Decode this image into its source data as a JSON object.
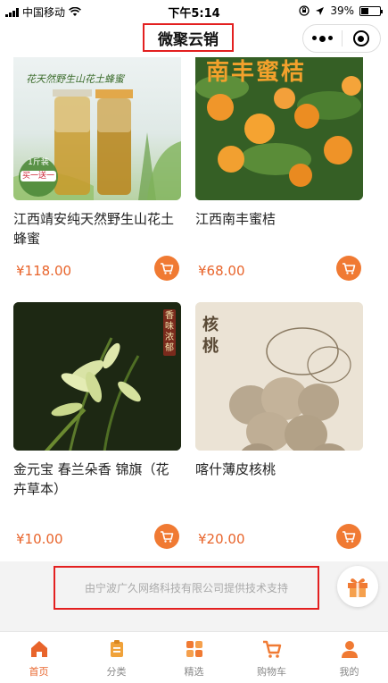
{
  "status_bar": {
    "carrier": "中国移动",
    "time": "下午5:14",
    "battery": "39%",
    "battery_level": 0.39
  },
  "nav": {
    "title": "微聚云销"
  },
  "products": [
    {
      "name": "江西靖安纯天然野生山花土蜂蜜",
      "price": "¥118.00",
      "image_text": "花天然野生山花土蜂蜜",
      "badge_line1": "1斤装",
      "badge_line2": "买一送一"
    },
    {
      "name": "江西南丰蜜桔",
      "price": "¥68.00",
      "image_text": "南丰蜜桔"
    },
    {
      "name": "金元宝 春兰朵香 锦旗（花卉草本）",
      "price": "¥10.00",
      "image_text": "香味浓郁"
    },
    {
      "name": "喀什薄皮核桃",
      "price": "¥20.00",
      "image_text": "核桃"
    }
  ],
  "footer": {
    "support_text": "由宁波广久网络科技有限公司提供技术支持"
  },
  "tabs": [
    {
      "label": "首页",
      "icon": "home-icon",
      "active": true
    },
    {
      "label": "分类",
      "icon": "category-icon",
      "active": false
    },
    {
      "label": "精选",
      "icon": "featured-icon",
      "active": false
    },
    {
      "label": "购物车",
      "icon": "cart-icon",
      "active": false
    },
    {
      "label": "我的",
      "icon": "user-icon",
      "active": false
    }
  ],
  "colors": {
    "accent": "#e8642b",
    "cart_button": "#f07a33",
    "highlight_border": "#e32020"
  }
}
